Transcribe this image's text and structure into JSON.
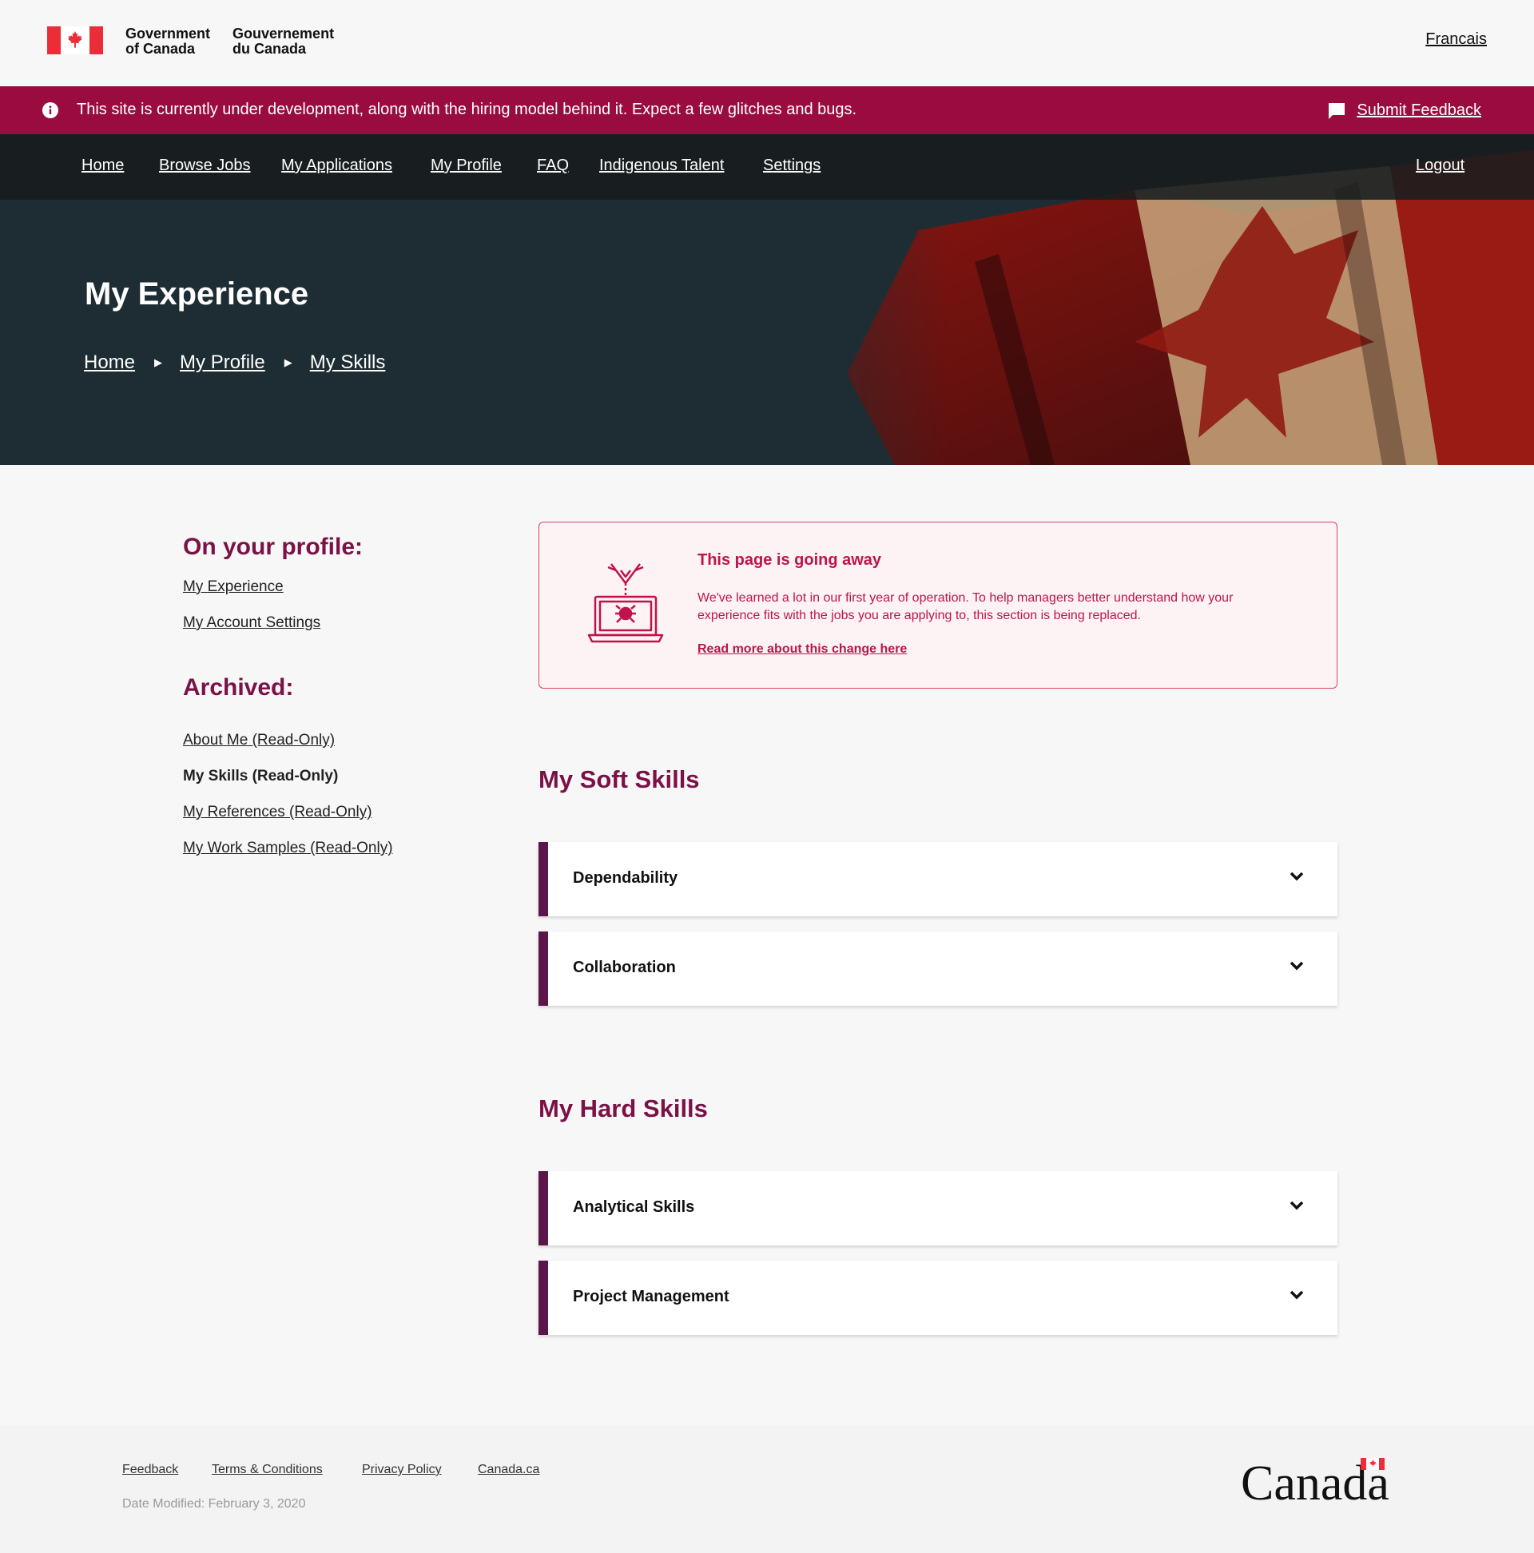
{
  "gov": {
    "name_en": "Government\nof Canada",
    "name_fr": "Gouvernement\ndu Canada",
    "language_link": "Francais"
  },
  "banner": {
    "message": "This site is currently under development, along with the hiring model behind it. Expect a few glitches and bugs.",
    "feedback_label": "Submit Feedback",
    "color": "#9a0c3f"
  },
  "nav": {
    "items": [
      "Home",
      "Browse Jobs",
      "My Applications",
      "My Profile",
      "FAQ",
      "Indigenous Talent",
      "Settings"
    ],
    "logout": "Logout"
  },
  "hero": {
    "title": "My Experience",
    "breadcrumbs": [
      "Home",
      "My Profile",
      "My Skills"
    ],
    "separator": "▶"
  },
  "sidebar": {
    "profile_heading": "On your profile:",
    "profile_links": [
      "My Experience",
      "My Account Settings"
    ],
    "archived_heading": "Archived:",
    "archived_links": [
      "About Me (Read-Only)",
      "My Skills (Read-Only)",
      "My References (Read-Only)",
      "My Work Samples (Read-Only)"
    ],
    "current": "My Skills (Read-Only)"
  },
  "notice": {
    "title": "This page is going away",
    "body": "We've learned a lot in our first year of operation. To help managers better understand how your experience fits with the jobs you are applying to, this section is being replaced.",
    "link": "Read more about this change here",
    "color": "#c0134b"
  },
  "soft_skills": {
    "title": "My Soft Skills",
    "items": [
      "Dependability",
      "Collaboration"
    ]
  },
  "hard_skills": {
    "title": "My Hard Skills",
    "items": [
      "Analytical Skills",
      "Project Management"
    ]
  },
  "footer": {
    "links": [
      "Feedback",
      "Terms & Conditions",
      "Privacy Policy",
      "Canada.ca"
    ],
    "date_modified": "Date Modified: February 3, 2020",
    "wordmark": "Canada"
  },
  "colors": {
    "accent": "#7b1146",
    "accordion_bar": "#5c1548"
  }
}
